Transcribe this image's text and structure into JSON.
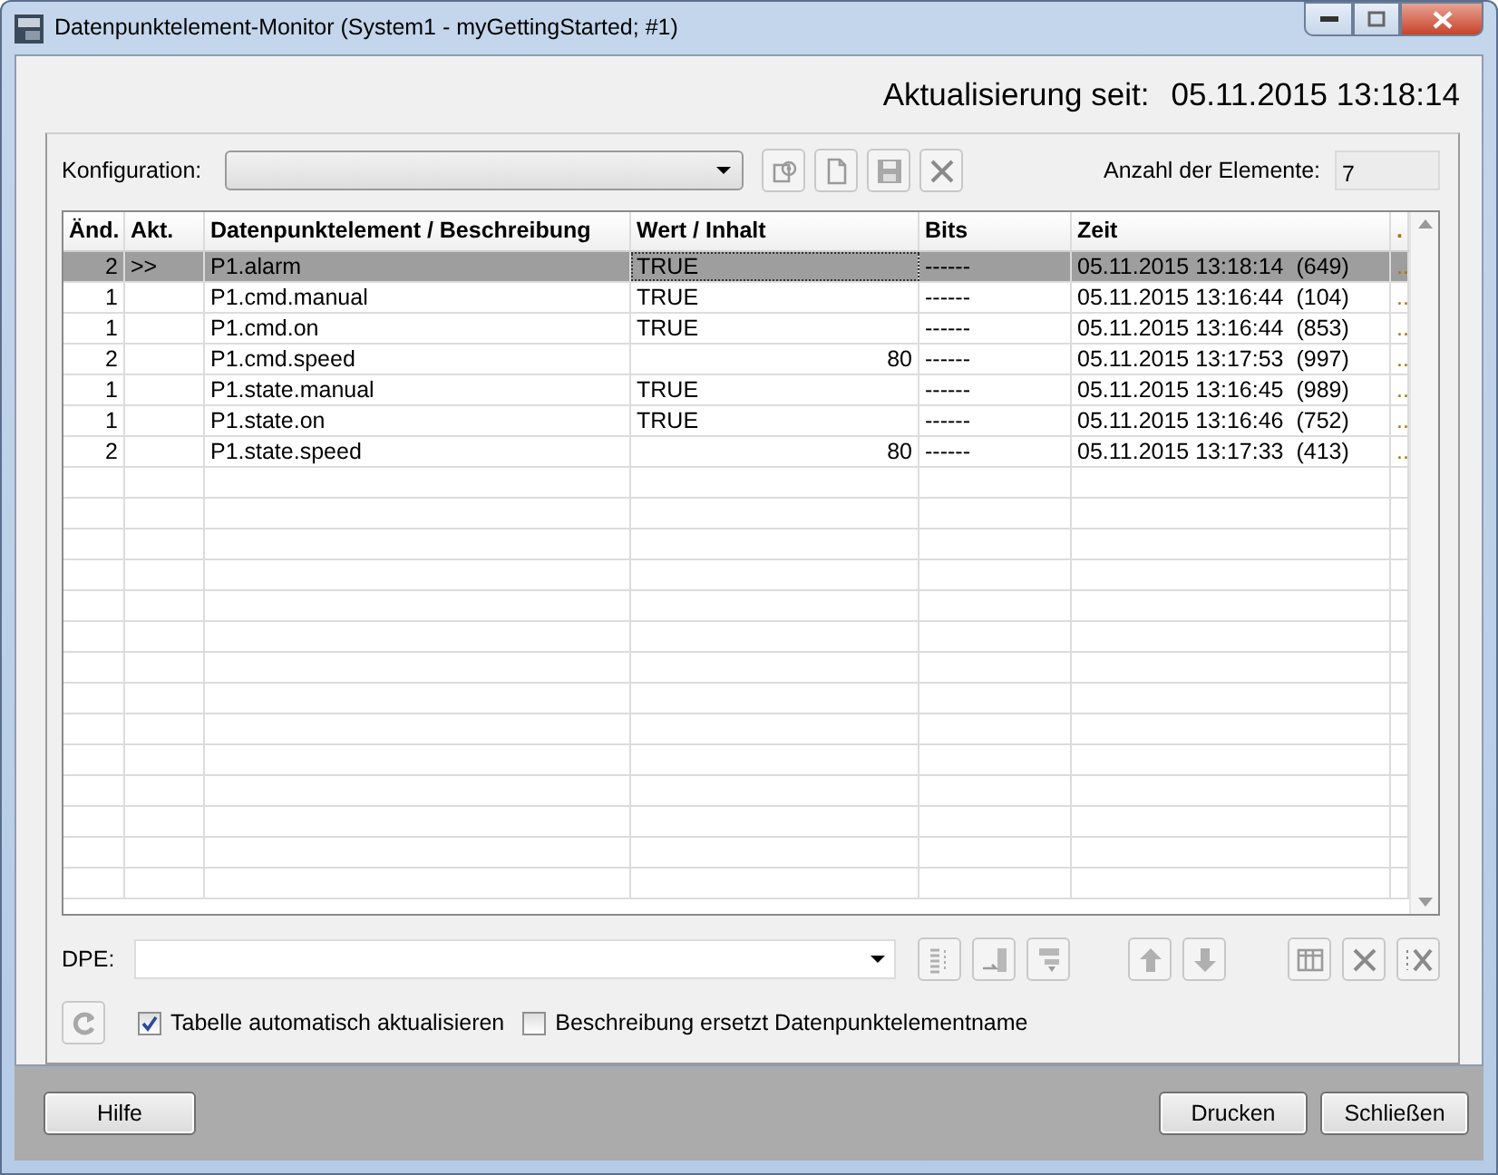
{
  "window": {
    "title": "Datenpunktelement-Monitor (System1 - myGettingStarted; #1)"
  },
  "update": {
    "label": "Aktualisierung seit:",
    "value": "05.11.2015 13:18:14"
  },
  "config": {
    "label": "Konfiguration:",
    "count_label": "Anzahl der Elemente:",
    "count": "7"
  },
  "table": {
    "columns": [
      "Änd.",
      "Akt.",
      "Datenpunktelement / Beschreibung",
      "Wert / Inhalt",
      "Bits",
      "Zeit",
      "."
    ],
    "rows": [
      {
        "kind": "text",
        "selected": true,
        "change": "2",
        "active": ">>",
        "element": "P1.alarm",
        "value": "TRUE",
        "bits": "------",
        "time": "05.11.2015 13:18:14  (649)",
        "column_7": ".."
      },
      {
        "kind": "text",
        "selected": false,
        "change": "1",
        "element": "P1.cmd.manual",
        "value": "TRUE",
        "bits": "------",
        "time": "05.11.2015 13:16:44  (104)",
        "column_7": ".."
      },
      {
        "kind": "text",
        "selected": false,
        "change": "1",
        "element": "P1.cmd.on",
        "value": "TRUE",
        "bits": "------",
        "time": "05.11.2015 13:16:44  (853)",
        "column_7": ".."
      },
      {
        "kind": "number",
        "selected": false,
        "change": "2",
        "element": "P1.cmd.speed",
        "value": "80",
        "bits": "------",
        "time": "05.11.2015 13:17:53  (997)",
        "column_7": ".."
      },
      {
        "kind": "text",
        "selected": false,
        "change": "1",
        "element": "P1.state.manual",
        "value": "TRUE",
        "bits": "------",
        "time": "05.11.2015 13:16:45  (989)",
        "column_7": ".."
      },
      {
        "kind": "text",
        "selected": false,
        "change": "1",
        "element": "P1.state.on",
        "value": "TRUE",
        "bits": "------",
        "time": "05.11.2015 13:16:46  (752)",
        "column_7": ".."
      },
      {
        "kind": "number",
        "selected": false,
        "change": "2",
        "element": "P1.state.speed",
        "value": "80",
        "bits": "------",
        "time": "05.11.2015 13:17:33  (413)",
        "column_7": ".."
      }
    ]
  },
  "dpe": {
    "label": "DPE:"
  },
  "options": [
    {
      "label": "Tabelle automatisch aktualisieren",
      "checked": true
    },
    {
      "label": "Beschreibung ersetzt Datenpunktelementname",
      "checked": false
    }
  ],
  "buttons": [
    {
      "label": "Hilfe"
    },
    {
      "label": "Drucken"
    },
    {
      "label": "Schließen"
    }
  ]
}
